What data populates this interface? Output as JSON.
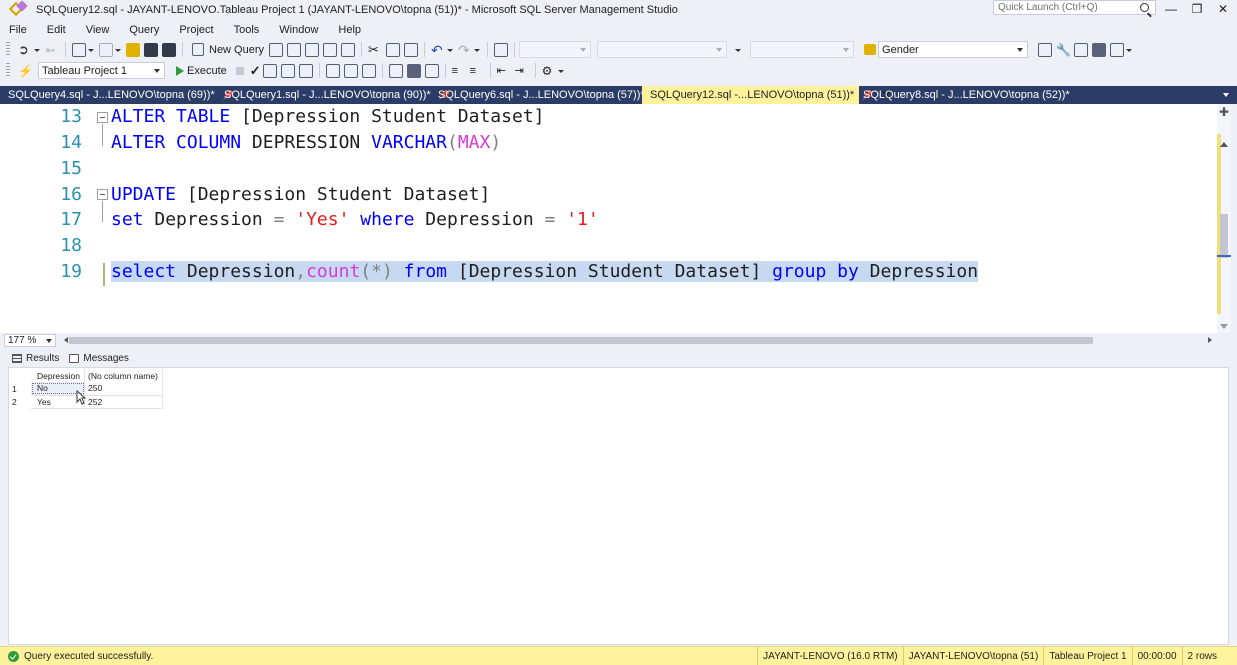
{
  "window": {
    "title": "SQLQuery12.sql - JAYANT-LENOVO.Tableau Project 1 (JAYANT-LENOVO\\topna (51))* - Microsoft SQL Server Management Studio",
    "quick_launch_placeholder": "Quick Launch (Ctrl+Q)",
    "controls": [
      "minimize",
      "restore",
      "close"
    ]
  },
  "menu": [
    "File",
    "Edit",
    "View",
    "Query",
    "Project",
    "Tools",
    "Window",
    "Help"
  ],
  "toolbar1": {
    "new_query_label": "New Query",
    "search_combo_value": "Gender"
  },
  "toolbar2": {
    "database_value": "Tableau Project 1",
    "execute_label": "Execute"
  },
  "tabs": [
    {
      "label": "SQLQuery4.sql - J...LENOVO\\topna (69))*",
      "active": false
    },
    {
      "label": "SQLQuery1.sql - J...LENOVO\\topna (90))*",
      "active": false
    },
    {
      "label": "SQLQuery6.sql - J...LENOVO\\topna (57))*",
      "active": false
    },
    {
      "label": "SQLQuery12.sql -...LENOVO\\topna (51))*",
      "active": true
    },
    {
      "label": "SQLQuery8.sql - J...LENOVO\\topna (52))*",
      "active": false
    }
  ],
  "editor": {
    "line_numbers": [
      "13",
      "14",
      "15",
      "16",
      "17",
      "18",
      "19"
    ],
    "lines": [
      "ALTER TABLE [Depression Student Dataset]",
      "ALTER COLUMN DEPRESSION VARCHAR(MAX)",
      "",
      "UPDATE [Depression Student Dataset]",
      "set Depression = 'Yes' where Depression = '1'",
      "",
      "select Depression,count(*) from [Depression Student Dataset] group by Depression"
    ],
    "zoom": "177 %"
  },
  "results_tabs": [
    "Results",
    "Messages"
  ],
  "results": {
    "columns": [
      "Depression",
      "(No column name)"
    ],
    "rows": [
      {
        "num": "1",
        "depression": "No",
        "count": "250"
      },
      {
        "num": "2",
        "depression": "Yes",
        "count": "252"
      }
    ]
  },
  "status": {
    "message": "Query executed successfully.",
    "server": "JAYANT-LENOVO (16.0 RTM)",
    "user": "JAYANT-LENOVO\\topna (51)",
    "database": "Tableau Project 1",
    "elapsed": "00:00:00",
    "rows": "2 rows"
  },
  "colors": {
    "tab_strip": "#2b3d66",
    "active_tab": "#fff29d",
    "status_bar": "#fff29d",
    "keyword": "#0000ff",
    "string": "#e31c1c",
    "function": "#d63ad6",
    "line_number": "#2b91af",
    "selection": "#c6d9f0"
  }
}
